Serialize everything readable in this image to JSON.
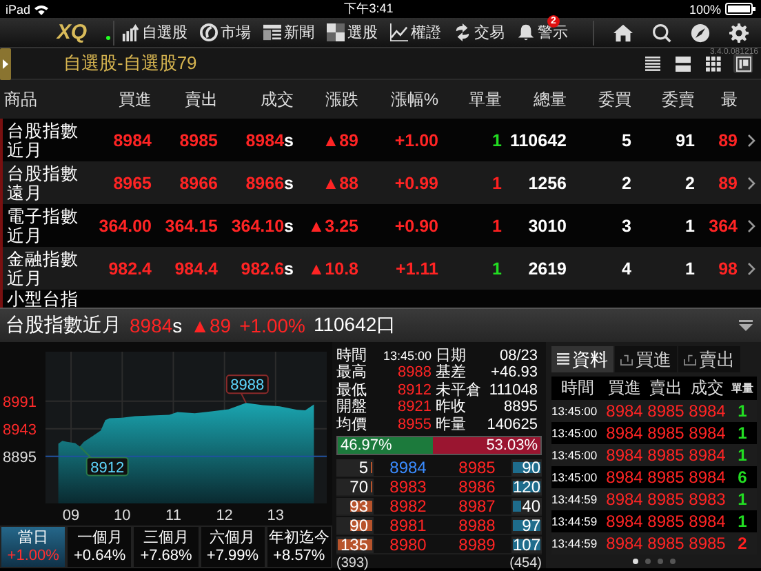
{
  "status_bar": {
    "device": "iPad",
    "time": "下午3:41",
    "battery": "100%"
  },
  "nav": {
    "logo": "XQ",
    "items": [
      {
        "kind": "watchlist",
        "label": "自選股"
      },
      {
        "kind": "market",
        "label": "市場"
      },
      {
        "kind": "news",
        "label": "新聞"
      },
      {
        "kind": "screener",
        "label": "選股"
      },
      {
        "kind": "warrant",
        "label": "權證"
      },
      {
        "kind": "trade",
        "label": "交易"
      },
      {
        "kind": "alert",
        "label": "警示",
        "badge": "2"
      }
    ],
    "version": "3.4.0.081216"
  },
  "title_bar": {
    "title": "自選股-自選股79",
    "view_buttons": [
      {
        "kind": "list",
        "selected": false
      },
      {
        "kind": "rows",
        "selected": false
      },
      {
        "kind": "grid",
        "selected": false
      },
      {
        "kind": "panel",
        "selected": true
      }
    ]
  },
  "quote_table": {
    "columns": [
      "商品",
      "買進",
      "賣出",
      "成交",
      "漲跌",
      "漲幅%",
      "單量",
      "總量",
      "委買",
      "委賣",
      "最"
    ],
    "rows": [
      {
        "name": "台股指數近月",
        "bid": "8984",
        "ask": "8985",
        "last": "8984",
        "last_suffix": "s",
        "change": "▲89",
        "pct": "+1.00",
        "tick_volume": "1",
        "color": "#22dd22",
        "volume": "110642",
        "bid_size": "5",
        "ask_size": "91",
        "column_11": "89"
      },
      {
        "name": "台股指數遠月",
        "bid": "8965",
        "ask": "8966",
        "last": "8966",
        "last_suffix": "s",
        "change": "▲88",
        "pct": "+0.99",
        "tick_volume": "1",
        "color": "#ff2020",
        "volume": "1256",
        "bid_size": "2",
        "ask_size": "2",
        "column_11": "89"
      },
      {
        "name": "電子指數近月",
        "bid": "364.00",
        "ask": "364.15",
        "last": "364.10",
        "last_suffix": "s",
        "change": "▲3.25",
        "pct": "+0.90",
        "tick_volume": "1",
        "color": "#ff2020",
        "volume": "3010",
        "bid_size": "3",
        "ask_size": "1",
        "column_11": "364"
      },
      {
        "name": "金融指數近月",
        "bid": "982.4",
        "ask": "984.4",
        "last": "982.6",
        "last_suffix": "s",
        "change": "▲10.8",
        "pct": "+1.11",
        "tick_volume": "1",
        "color": "#22dd22",
        "volume": "2619",
        "bid_size": "4",
        "ask_size": "1",
        "column_11": "98"
      }
    ],
    "partial_row": {
      "name": "小型台指"
    }
  },
  "detail": {
    "name": "台股指數近月",
    "last": "8984",
    "last_suffix": "s",
    "change": "▲89",
    "pct": "+1.00%",
    "volume": "110642口",
    "chart_data": {
      "type": "area",
      "xlim": [
        8.5,
        14
      ],
      "ylim": [
        8813,
        9077
      ],
      "ref_lines": [
        {
          "axis": "y",
          "value": 8895
        }
      ],
      "grid": true,
      "x": [
        8.75,
        8.83,
        8.92,
        9.08,
        9.17,
        9.25,
        9.42,
        9.58,
        9.67,
        9.75,
        10,
        10.25,
        10.58,
        10.92,
        11.08,
        11.42,
        11.75,
        12.08,
        12.42,
        12.75,
        13.08,
        13.42,
        13.58,
        13.75
      ],
      "series": [
        {
          "color": "#1aa5b0",
          "values": [
            8917,
            8922,
            8920,
            8918,
            8912,
            8920,
            8930,
            8940,
            8958,
            8961,
            8962,
            8965,
            8966,
            8967,
            8972,
            8970,
            8973,
            8977,
            8988,
            8984,
            8982,
            8976,
            8975,
            8985
          ]
        }
      ],
      "xticks": [
        {
          "value": 9,
          "label": "09"
        },
        {
          "value": 10,
          "label": "10"
        },
        {
          "value": 11,
          "label": "11"
        },
        {
          "value": 12,
          "label": "12"
        },
        {
          "value": 13,
          "label": "13"
        }
      ],
      "yticks": [
        {
          "value": 8991,
          "label": "8991"
        },
        {
          "value": 8943,
          "label": "8943"
        },
        {
          "value": 8895,
          "label": "8895"
        }
      ],
      "annotations": [
        {
          "x": 12.42,
          "y": 8988,
          "text": "8988"
        },
        {
          "x": 9.17,
          "y": 8912,
          "text": "8912"
        }
      ]
    },
    "period_tabs": [
      {
        "label": "當日",
        "pct": "+1.00%",
        "selected": true
      },
      {
        "label": "一個月",
        "pct": "+0.64%",
        "selected": false
      },
      {
        "label": "三個月",
        "pct": "+7.68%",
        "selected": false
      },
      {
        "label": "六個月",
        "pct": "+7.99%",
        "selected": false
      },
      {
        "label": "年初迄今",
        "pct": "+8.57%",
        "selected": false
      }
    ],
    "info": [
      {
        "label": "時間",
        "value": "13:45:00",
        "kind": "plain"
      },
      {
        "label": "日期",
        "value": "08/23",
        "kind": "plain"
      },
      {
        "label": "最高",
        "value": "8988",
        "kind": "price"
      },
      {
        "label": "基差",
        "value": "+46.93",
        "kind": "plain"
      },
      {
        "label": "最低",
        "value": "8912",
        "kind": "price"
      },
      {
        "label": "未平倉",
        "value": "111048",
        "kind": "plain"
      },
      {
        "label": "開盤",
        "value": "8921",
        "kind": "price"
      },
      {
        "label": "昨收",
        "value": "8895",
        "kind": "plain"
      },
      {
        "label": "均價",
        "value": "8955",
        "kind": "price"
      },
      {
        "label": "昨量",
        "value": "140625",
        "kind": "plain"
      }
    ],
    "ratio": {
      "buy": "46.97%",
      "sell": "53.03%",
      "level": 0.4697
    },
    "book": [
      {
        "bid_volume": "5",
        "bid_bar": {
          "level": 0.04
        },
        "bid": "8984",
        "bid_match": true,
        "ask": "8985",
        "ask_volume": "90",
        "ask_bar": {
          "level": 1
        }
      },
      {
        "bid_volume": "70",
        "bid_bar": {
          "level": 0.04
        },
        "bid": "8983",
        "bid_match": false,
        "ask": "8986",
        "ask_volume": "120",
        "ask_bar": {
          "level": 1
        }
      },
      {
        "bid_volume": "93",
        "bid_bar": {
          "level": 0.66
        },
        "bid": "8982",
        "bid_match": false,
        "ask": "8987",
        "ask_volume": "40",
        "ask_bar": {
          "level": 0.3
        }
      },
      {
        "bid_volume": "90",
        "bid_bar": {
          "level": 0.66
        },
        "bid": "8981",
        "bid_match": false,
        "ask": "8988",
        "ask_volume": "97",
        "ask_bar": {
          "level": 1
        }
      },
      {
        "bid_volume": "135",
        "bid_bar": {
          "level": 1
        },
        "bid": "8980",
        "bid_match": false,
        "ask": "8989",
        "ask_volume": "107",
        "ask_bar": {
          "level": 1
        }
      }
    ],
    "book_totals": {
      "bid": "(393)",
      "ask": "(454)"
    },
    "ticks_panel": {
      "tabs": [
        {
          "kind": "list",
          "label": "資料",
          "selected": true
        },
        {
          "kind": "buy",
          "label": "買進",
          "selected": false
        },
        {
          "kind": "sell",
          "label": "賣出",
          "selected": false
        }
      ],
      "columns": [
        "時間",
        "買進",
        "賣出",
        "成交",
        "單量"
      ],
      "rows": [
        {
          "time": "13:45:00",
          "bid": "8984",
          "ask": "8985",
          "last": "8984",
          "volume": "1",
          "color": "#22dd22"
        },
        {
          "time": "13:45:00",
          "bid": "8984",
          "ask": "8985",
          "last": "8984",
          "volume": "1",
          "color": "#22dd22"
        },
        {
          "time": "13:45:00",
          "bid": "8984",
          "ask": "8985",
          "last": "8984",
          "volume": "1",
          "color": "#22dd22"
        },
        {
          "time": "13:45:00",
          "bid": "8984",
          "ask": "8985",
          "last": "8984",
          "volume": "6",
          "color": "#22dd22"
        },
        {
          "time": "13:44:59",
          "bid": "8984",
          "ask": "8985",
          "last": "8983",
          "volume": "1",
          "color": "#22dd22"
        },
        {
          "time": "13:44:59",
          "bid": "8984",
          "ask": "8985",
          "last": "8984",
          "volume": "1",
          "color": "#22dd22"
        },
        {
          "time": "13:44:59",
          "bid": "8984",
          "ask": "8985",
          "last": "8985",
          "volume": "2",
          "color": "#ff2020"
        }
      ],
      "pages": [
        {
          "selected": true
        },
        {
          "selected": false
        },
        {
          "selected": false
        },
        {
          "selected": false
        }
      ]
    }
  }
}
